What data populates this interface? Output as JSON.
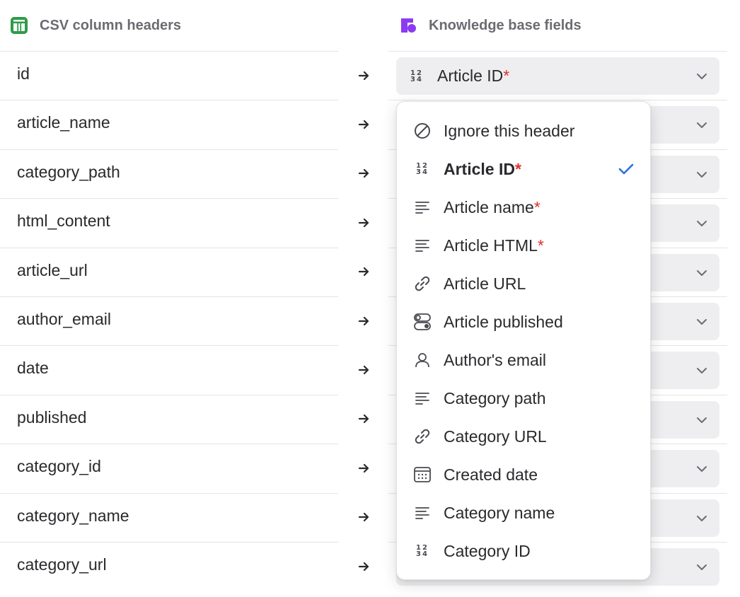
{
  "headers": {
    "csv_title": "CSV column headers",
    "kb_title": "Knowledge base fields",
    "csv_icon": "spreadsheet-icon",
    "kb_icon": "knowledge-base-icon"
  },
  "csv_rows": [
    {
      "label": "id"
    },
    {
      "label": "article_name"
    },
    {
      "label": "category_path"
    },
    {
      "label": "html_content"
    },
    {
      "label": "article_url"
    },
    {
      "label": "author_email"
    },
    {
      "label": "date"
    },
    {
      "label": "published"
    },
    {
      "label": "category_id"
    },
    {
      "label": "category_name"
    },
    {
      "label": "category_url"
    }
  ],
  "mapping": {
    "selected_label": "Article ID",
    "selected_required": "*",
    "selected_icon": "number-icon"
  },
  "dropdown": {
    "options": [
      {
        "label": "Ignore this header",
        "req": "",
        "icon": "ignore-icon"
      },
      {
        "label": "Article ID",
        "req": "*",
        "icon": "number-icon",
        "selected": true
      },
      {
        "label": "Article name",
        "req": "*",
        "icon": "text-icon"
      },
      {
        "label": "Article HTML",
        "req": "*",
        "icon": "text-icon"
      },
      {
        "label": "Article URL",
        "req": "",
        "icon": "link-icon"
      },
      {
        "label": "Article published",
        "req": "",
        "icon": "toggle-icon"
      },
      {
        "label": "Author's email",
        "req": "",
        "icon": "user-icon"
      },
      {
        "label": "Category path",
        "req": "",
        "icon": "text-icon"
      },
      {
        "label": "Category URL",
        "req": "",
        "icon": "link-icon"
      },
      {
        "label": "Created date",
        "req": "",
        "icon": "calendar-icon"
      },
      {
        "label": "Category name",
        "req": "",
        "icon": "text-icon"
      },
      {
        "label": "Category ID",
        "req": "",
        "icon": "number-icon"
      }
    ]
  },
  "colors": {
    "required": "#e0302c",
    "check": "#2f6fe0",
    "spreadsheet_icon": "#2e9b48",
    "kb_icon": "#8b3cf0"
  }
}
